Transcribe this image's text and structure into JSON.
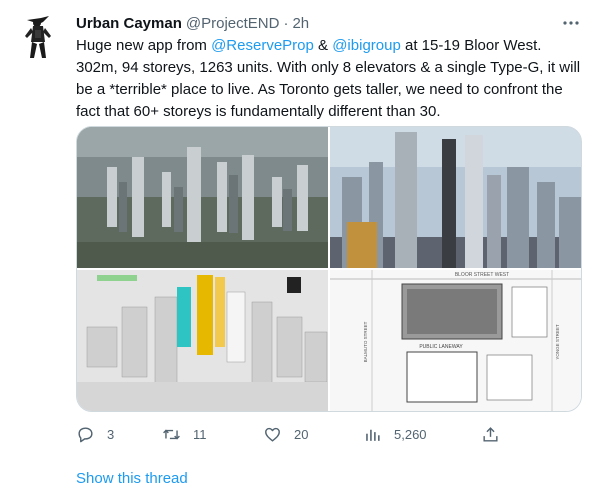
{
  "tweet": {
    "display_name": "Urban Cayman",
    "handle": "@ProjectEND",
    "separator": "·",
    "time": "2h",
    "text": {
      "part1": "Huge new app from ",
      "mention1": "@ReserveProp",
      "part2": " & ",
      "mention2": "@ibigroup",
      "part3": " at 15-19 Bloor West. 302m, 94 storeys, 1263 units. With only 8 elevators & a single Type-G, it will be a *terrible* place to live. As Toronto gets taller, we need to confront the fact that 60+ storeys is fundamentally different than 30."
    },
    "media": {
      "site_plan_labels": {
        "street_top": "BLOOR STREET WEST",
        "street_left": "BALMUTO STREET",
        "street_right": "YONGE STREET",
        "lane": "PUBLIC LANEWAY"
      }
    },
    "actions": {
      "replies": "3",
      "retweets": "11",
      "likes": "20",
      "views": "5,260"
    },
    "show_thread": "Show this thread"
  },
  "icons": {
    "avatar": "crocodile-figure-avatar",
    "more": "more-horizontal-icon",
    "reply": "reply-icon",
    "retweet": "retweet-icon",
    "like": "heart-icon",
    "views": "views-bar-chart-icon",
    "share": "share-icon"
  },
  "colors": {
    "link": "#1d9bf0",
    "secondary_text": "#536471",
    "primary_text": "#0f1419",
    "border": "#cfd9de"
  }
}
